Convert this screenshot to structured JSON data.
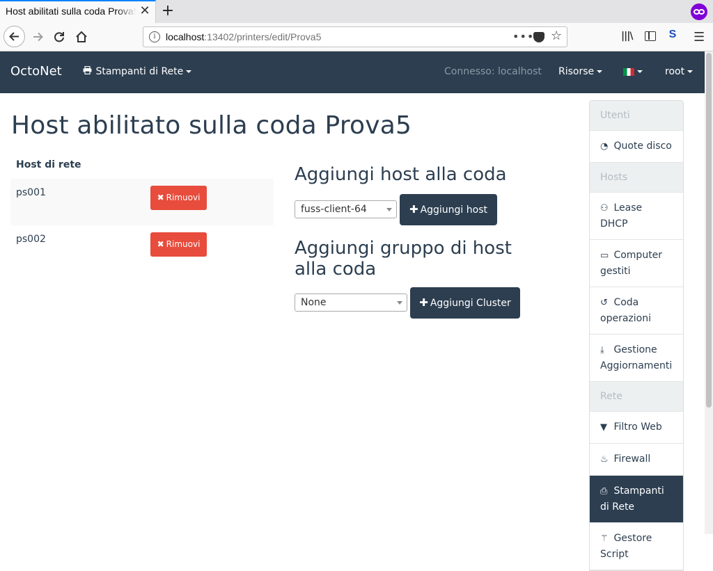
{
  "browser": {
    "tab_title": "Host abilitati sulla coda Prova5",
    "url_host": "localhost",
    "url_rest": ":13402/printers/edit/Prova5"
  },
  "navbar": {
    "brand": "OctoNet",
    "printers_menu": "Stampanti di Rete",
    "connected": "Connesso: localhost",
    "resources_menu": "Risorse",
    "user_menu": "root"
  },
  "main": {
    "title": "Host abilitato sulla coda Prova5",
    "hosts_header": "Host di rete",
    "hosts": [
      {
        "name": "ps001",
        "remove_label": "Rimuovi"
      },
      {
        "name": "ps002",
        "remove_label": "Rimuovi"
      }
    ],
    "add_host_title": "Aggiungi host alla coda",
    "host_select_value": "fuss-client-64",
    "add_host_button": "Aggiungi host",
    "add_group_title": "Aggiungi gruppo di host alla coda",
    "cluster_select_value": "None",
    "add_cluster_button": "Aggiungi Cluster"
  },
  "sidebar": {
    "items": [
      {
        "label": "Utenti",
        "type": "header"
      },
      {
        "label": "Quote disco",
        "icon": "pie-chart-icon"
      },
      {
        "label": "Hosts",
        "type": "header"
      },
      {
        "label": "Lease DHCP",
        "icon": "handshake-icon"
      },
      {
        "label": "Computer gestiti",
        "icon": "desktop-icon"
      },
      {
        "label": "Coda operazioni",
        "icon": "history-icon"
      },
      {
        "label": "Gestione Aggiornamenti",
        "icon": "download-icon"
      },
      {
        "label": "Rete",
        "type": "header"
      },
      {
        "label": "Filtro Web",
        "icon": "filter-icon"
      },
      {
        "label": "Firewall",
        "icon": "fire-icon"
      },
      {
        "label": "Stampanti di Rete",
        "icon": "printer-icon",
        "active": true
      },
      {
        "label": "Gestore Script",
        "icon": "magic-wand-icon"
      }
    ]
  },
  "colors": {
    "navbar_bg": "#2c3e50",
    "danger": "#e74c3c",
    "sidebar_header_bg": "#ecf0f1"
  }
}
